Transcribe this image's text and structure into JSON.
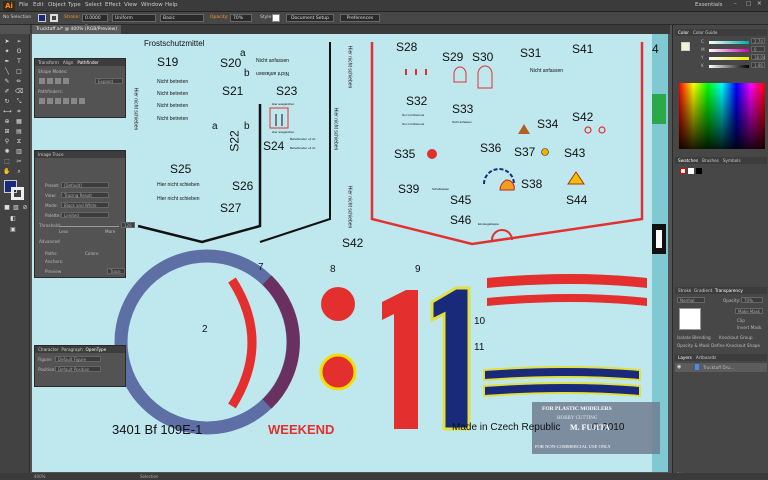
{
  "menubar": {
    "logo": "Ai",
    "items": [
      "File",
      "Edit",
      "Object",
      "Type",
      "Select",
      "Effect",
      "View",
      "Window",
      "Help"
    ],
    "workspace": "Essentials"
  },
  "control_bar": {
    "selection": "No Selection",
    "stroke_label": "Stroke:",
    "stroke_value": "0.0000 p",
    "uniform": "Uniform",
    "basic": "Basic",
    "opacity_label": "Opacity:",
    "opacity_value": "70%",
    "style_label": "Style:",
    "doc_setup": "Document Setup",
    "preferences": "Preferences"
  },
  "document_tab": "Trucktaff.ai* @ 400% (RGB/Preview)",
  "panels": {
    "pathfinder": {
      "tabs": [
        "Transform",
        "Align",
        "Pathfinder"
      ],
      "shape_modes": "Shape Modes:",
      "expand": "Expand",
      "pathfinders": "Pathfinders:"
    },
    "image_trace": {
      "title": "Image Trace",
      "rows": [
        {
          "label": "Preset:",
          "value": "[Default]"
        },
        {
          "label": "View:",
          "value": "Tracing Result"
        },
        {
          "label": "Mode:",
          "value": "Black and White"
        },
        {
          "label": "Palette:",
          "value": "Limited"
        }
      ],
      "threshold": "Threshold:",
      "threshold_value": "128",
      "less": "Less",
      "more": "More",
      "advanced": "Advanced",
      "paths": "Paths:",
      "colors": "Colors:",
      "anchors": "Anchors:",
      "preview": "Preview",
      "trace": "Trace"
    },
    "opentype": {
      "tabs": [
        "Character",
        "Paragraph",
        "OpenType"
      ],
      "figure_label": "Figure:",
      "figure_value": "Default Figure",
      "position_label": "Position:",
      "position_value": "Default Position"
    },
    "color": {
      "tabs": [
        "Color",
        "Color Guide"
      ],
      "channels": [
        {
          "name": "C",
          "value": "2.74"
        },
        {
          "name": "M",
          "value": "0"
        },
        {
          "name": "Y",
          "value": "18.04"
        },
        {
          "name": "K",
          "value": "1.96"
        }
      ],
      "hex": "EDF5D7"
    },
    "swatches": {
      "tabs": [
        "Swatches",
        "Brushes",
        "Symbols"
      ]
    },
    "transparency": {
      "tabs": [
        "Stroke",
        "Gradient",
        "Transparency"
      ],
      "mode": "Normal",
      "opacity_label": "Opacity:",
      "opacity_value": "70%",
      "make_mask": "Make Mask",
      "clip": "Clip",
      "invert_mask": "Invert Mask",
      "isolate": "Isolate Blending",
      "knockout": "Knockout Group",
      "opacity_mask": "Opacity & Mask Define Knockout Shape"
    },
    "layers": {
      "tabs": [
        "Layers",
        "Artboards"
      ],
      "layer_name": "Trucktaff Dru...",
      "footer": "1 Layer"
    }
  },
  "status_bar": {
    "zoom": "400%",
    "tool": "Selection"
  },
  "artwork": {
    "top_header": "Frostschutzmittel",
    "labels": [
      "S19",
      "S20",
      "a",
      "b",
      "S21",
      "S22",
      "S23",
      "a",
      "b",
      "S24",
      "S25",
      "S26",
      "S27",
      "S28",
      "S29",
      "S30",
      "S31",
      "S41",
      "S32",
      "S33",
      "S34",
      "S42",
      "S35",
      "S36",
      "S37",
      "S43",
      "S38",
      "S39",
      "S45",
      "S44",
      "S46",
      "S42",
      "4"
    ],
    "nicht_betreten": [
      "Nicht betreten",
      "Nicht betreten",
      "Nicht betreten",
      "Nicht betreten"
    ],
    "hier_nicht_schieben": [
      "Hier nicht schieben",
      "Hier nicht schieben"
    ],
    "nicht_anfassen": [
      "Nicht anfassen",
      "Nicht anfassen",
      "Nicht anfassen"
    ],
    "vertical_text": [
      "Hier nicht schieben",
      "Hier nicht schieben",
      "Hier nicht schieben",
      "Hier nicht schieben"
    ],
    "small_text": [
      "Hier ausgleichen",
      "Hier ausgleichen",
      "Nur mit Motoroel",
      "Nur mit Motoroel",
      "Behelfsruder +6 cb",
      "Behelfsruder +6 cb",
      "Nicht anfassen",
      "Einstiegsklappe",
      "Schaltkasten"
    ],
    "numbers": [
      "1",
      "2",
      "7",
      "8",
      "9",
      "10",
      "11"
    ],
    "big_number": "11",
    "product": "3401 Bf 109E-1",
    "brand": "WEEKEND",
    "made_in": "Made in Czech Republic",
    "copyright": "© 2010",
    "watermark": {
      "line1": "FOR PLASTIC MODELERS",
      "line2": "HOBBY CUTTING",
      "line3": "M. FUJITA",
      "line4": "FOR NON-COMMERCIAL USE ONLY"
    }
  }
}
